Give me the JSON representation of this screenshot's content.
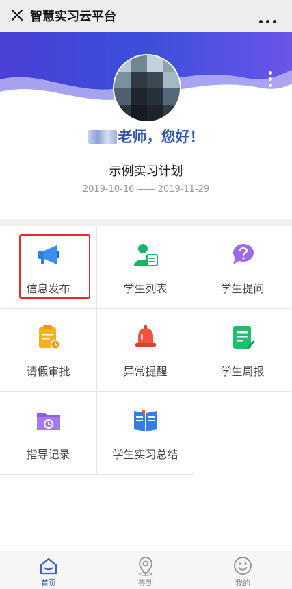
{
  "window": {
    "title": "智慧实习云平台"
  },
  "greeting": {
    "suffix": "老师，您好！"
  },
  "plan": {
    "title": "示例实习计划",
    "dates": "2019-10-16 —— 2019-11-29"
  },
  "grid": {
    "items": [
      {
        "label": "信息发布",
        "icon": "megaphone-icon"
      },
      {
        "label": "学生列表",
        "icon": "student-list-icon"
      },
      {
        "label": "学生提问",
        "icon": "question-icon"
      },
      {
        "label": "请假审批",
        "icon": "leave-approval-icon"
      },
      {
        "label": "异常提醒",
        "icon": "alarm-bell-icon"
      },
      {
        "label": "学生周报",
        "icon": "weekly-report-icon"
      },
      {
        "label": "指导记录",
        "icon": "guidance-folder-icon"
      },
      {
        "label": "学生实习总结",
        "icon": "summary-book-icon"
      }
    ]
  },
  "tabbar": {
    "items": [
      {
        "label": "首页",
        "icon": "home-icon",
        "active": true
      },
      {
        "label": "签到",
        "icon": "location-pin-icon",
        "active": false
      },
      {
        "label": "我的",
        "icon": "smiley-icon",
        "active": false
      }
    ]
  },
  "colors": {
    "accent": "#3d5fc0",
    "greeting": "#2f55b5",
    "highlight_border": "#e22b2b"
  }
}
